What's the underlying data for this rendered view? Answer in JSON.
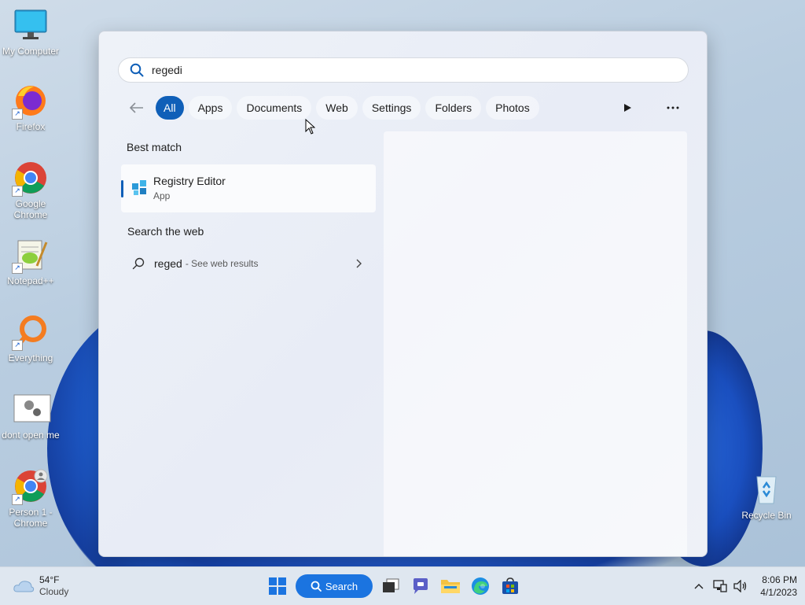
{
  "desktop": {
    "icons": [
      {
        "label": "My Computer",
        "icon": "computer-icon"
      },
      {
        "label": "Firefox",
        "icon": "firefox-icon"
      },
      {
        "label": "Google Chrome",
        "icon": "chrome-icon"
      },
      {
        "label": "Notepad++",
        "icon": "notepadpp-icon"
      },
      {
        "label": "Everything",
        "icon": "everything-search-icon"
      },
      {
        "label": "dont open me",
        "icon": "settings-file-icon"
      },
      {
        "label": "Person 1 - Chrome",
        "icon": "chrome-profile-icon"
      }
    ],
    "recycle_bin": {
      "label": "Recycle Bin",
      "icon": "recycle-bin-icon"
    }
  },
  "start": {
    "search": {
      "value": "regedi",
      "icon": "search-icon"
    },
    "filters": [
      {
        "label": "All",
        "active": true
      },
      {
        "label": "Apps"
      },
      {
        "label": "Documents"
      },
      {
        "label": "Web"
      },
      {
        "label": "Settings"
      },
      {
        "label": "Folders"
      },
      {
        "label": "Photos"
      }
    ],
    "best_match_label": "Best match",
    "best_match": {
      "title": "Registry Editor",
      "subtitle": "App",
      "icon": "registry-editor-icon"
    },
    "search_web_label": "Search the web",
    "web_result": {
      "query": "reged",
      "suffix": " - See web results"
    }
  },
  "taskbar": {
    "weather": {
      "temp": "54°F",
      "condition": "Cloudy",
      "icon": "cloud-icon"
    },
    "search_label": "Search",
    "clock": {
      "time": "8:06 PM",
      "date": "4/1/2023"
    }
  },
  "colors": {
    "accent": "#0f5fb8",
    "taskbar_search": "#1b74e0"
  }
}
